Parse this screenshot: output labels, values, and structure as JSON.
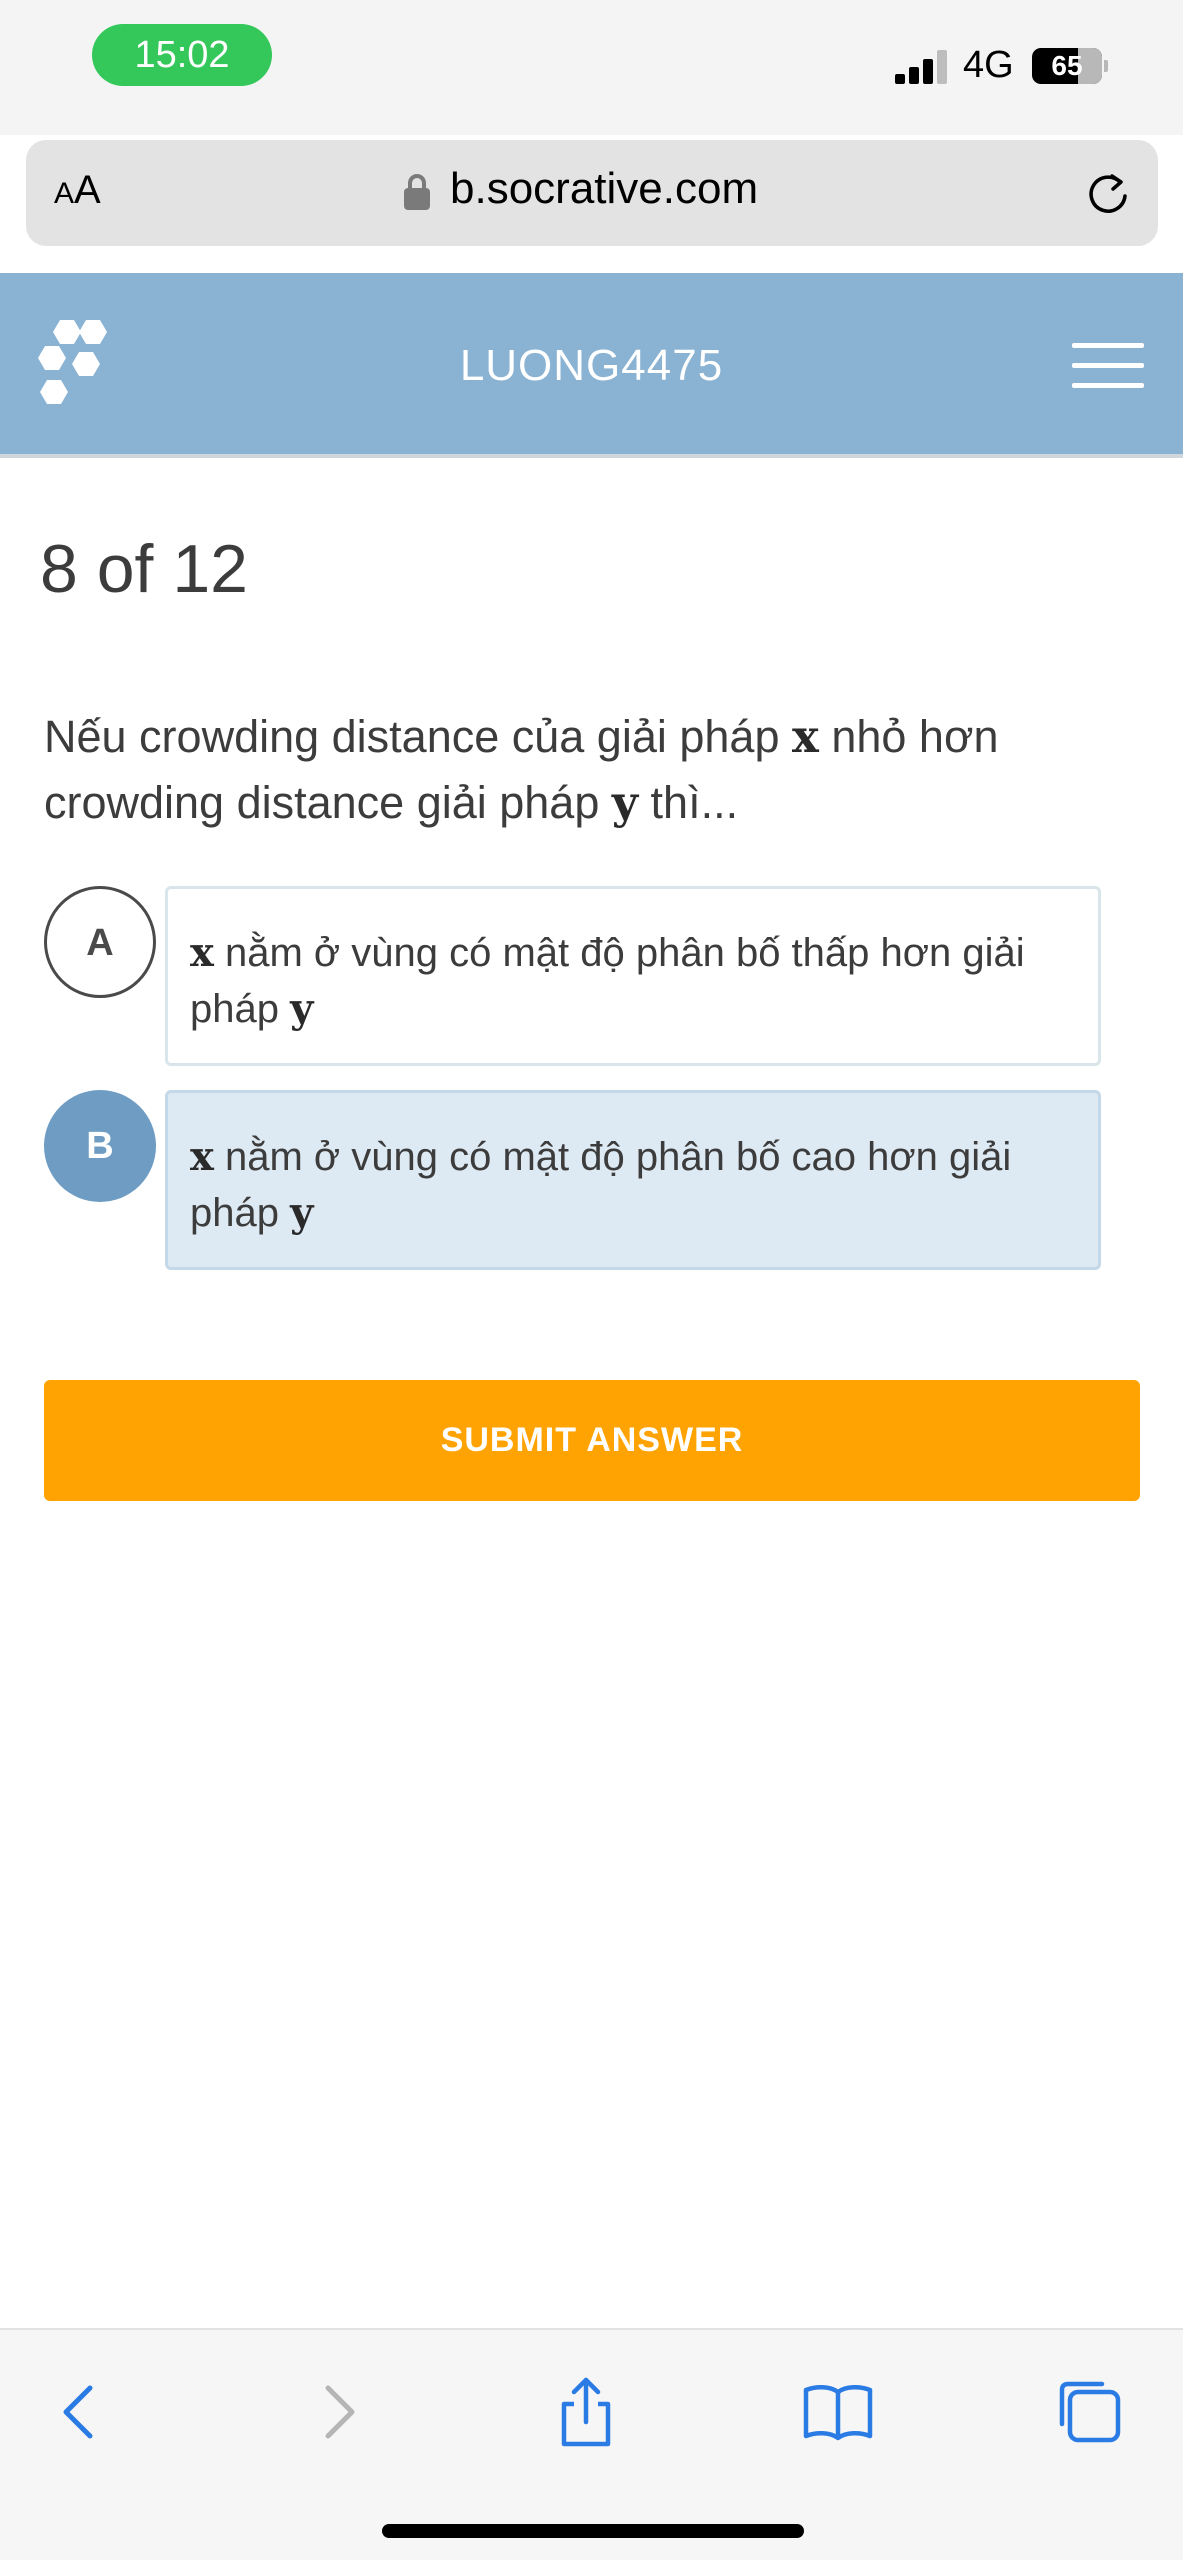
{
  "status_bar": {
    "time": "15:02",
    "network": "4G",
    "battery": "65"
  },
  "browser": {
    "aa_small": "A",
    "aa_large": "A",
    "url": "b.socrative.com"
  },
  "header": {
    "room_name": "LUONG4475"
  },
  "quiz": {
    "progress": "8 of 12",
    "question": {
      "part1": "Nếu crowding distance của giải pháp ",
      "var1": "x",
      "part2": " nhỏ hơn crowding distance giải pháp ",
      "var2": "y",
      "part3": " thì..."
    },
    "choices": [
      {
        "letter": "A",
        "var1": "x",
        "text": " nằm ở vùng có mật độ phân bố thấp hơn giải pháp ",
        "var2": "y",
        "selected": false
      },
      {
        "letter": "B",
        "var1": "x",
        "text": " nằm ở vùng có mật độ phân bố cao hơn giải pháp ",
        "var2": "y",
        "selected": true
      }
    ],
    "submit_label": "SUBMIT ANSWER"
  },
  "colors": {
    "header_bg": "#89b2d3",
    "submit_bg": "#ffa302",
    "selected_circle": "#6e9cc3",
    "selected_box": "#dde9f3",
    "time_pill": "#34c759",
    "ios_blue": "#2b7be5"
  },
  "toolbar_icons": [
    "back-icon",
    "forward-icon",
    "share-icon",
    "bookmarks-icon",
    "tabs-icon"
  ]
}
